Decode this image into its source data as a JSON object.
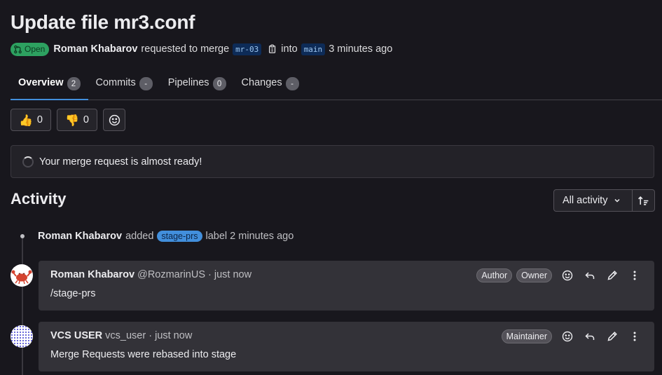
{
  "mr": {
    "title": "Update file mr3.conf",
    "status": "Open",
    "author": "Roman Khabarov",
    "action": "requested to merge",
    "source_branch": "mr-03",
    "into": "into",
    "target_branch": "main",
    "time": "3 minutes ago"
  },
  "tabs": [
    {
      "label": "Overview",
      "count": "2"
    },
    {
      "label": "Commits",
      "count": "-"
    },
    {
      "label": "Pipelines",
      "count": "0"
    },
    {
      "label": "Changes",
      "count": "-"
    }
  ],
  "reactions": {
    "thumbsup": {
      "emoji": "👍",
      "count": "0"
    },
    "thumbsdown": {
      "emoji": "👎",
      "count": "0"
    }
  },
  "ready_message": "Your merge request is almost ready!",
  "activity": {
    "heading": "Activity",
    "filter_label": "All activity"
  },
  "system_note": {
    "author": "Roman Khabarov",
    "action": "added",
    "label": "stage-prs",
    "suffix": "label",
    "time": "2 minutes ago"
  },
  "notes": [
    {
      "author": "Roman Khabarov",
      "handle": "@RozmarinUS",
      "time": "· just now",
      "body": "/stage-prs",
      "roles": [
        "Author",
        "Owner"
      ]
    },
    {
      "author": "VCS USER",
      "handle": "vcs_user",
      "time": "· just now",
      "body": "Merge Requests were rebased into stage",
      "roles": [
        "Maintainer"
      ]
    }
  ],
  "colors": {
    "background": "#18171d",
    "open_badge": "#2da160",
    "accent": "#428fdc",
    "note_bg": "#333238"
  }
}
